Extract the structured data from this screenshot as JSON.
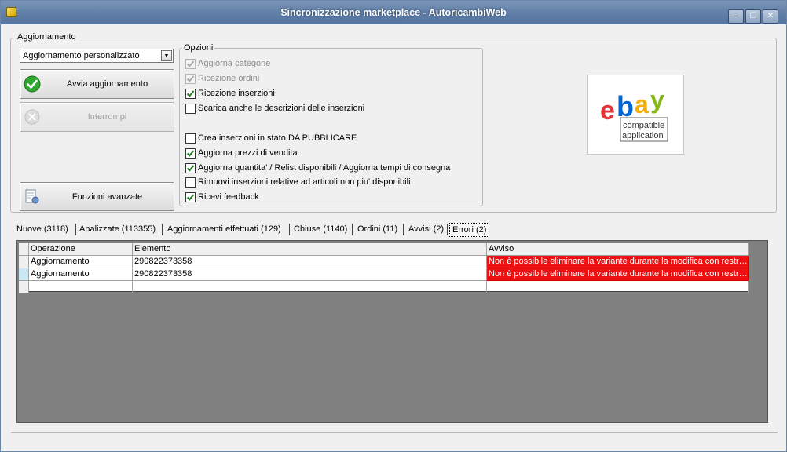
{
  "window": {
    "title": "Sincronizzazione marketplace - AutoricambiWeb",
    "controls": {
      "minimize": "—",
      "maximize": "☐",
      "close": "✕"
    }
  },
  "aggiornamento": {
    "legend": "Aggiornamento",
    "mode_select": "Aggiornamento personalizzato",
    "start_button": "Avvia aggiornamento",
    "stop_button": "Interrompi",
    "advanced_button": "Funzioni avanzate"
  },
  "opzioni": {
    "legend": "Opzioni",
    "items": [
      {
        "label": "Aggiorna categorie",
        "checked": true,
        "enabled": false
      },
      {
        "label": "Ricezione ordini",
        "checked": true,
        "enabled": false
      },
      {
        "label": "Ricezione inserzioni",
        "checked": true,
        "enabled": true
      },
      {
        "label": "Scarica anche le descrizioni delle inserzioni",
        "checked": false,
        "enabled": true
      },
      {
        "label": "Crea inserzioni in stato DA PUBBLICARE",
        "checked": false,
        "enabled": true
      },
      {
        "label": "Aggiorna prezzi di vendita",
        "checked": true,
        "enabled": true
      },
      {
        "label": "Aggiorna quantita' / Relist disponibili / Aggiorna tempi di consegna",
        "checked": true,
        "enabled": true
      },
      {
        "label": "Rimuovi inserzioni relative ad articoli non piu' disponibili",
        "checked": false,
        "enabled": true
      },
      {
        "label": "Ricevi feedback",
        "checked": true,
        "enabled": true
      }
    ]
  },
  "logo": {
    "letters": [
      "e",
      "b",
      "a",
      "y"
    ],
    "line1": "compatible",
    "line2": "application"
  },
  "tabs": [
    {
      "label": "Nuove (3118)"
    },
    {
      "label": "Analizzate (113355)"
    },
    {
      "label": "Aggiornamenti effettuati (129)"
    },
    {
      "label": "Chiuse (1140)"
    },
    {
      "label": "Ordini (11)"
    },
    {
      "label": "Avvisi (2)"
    },
    {
      "label": "Errori (2)",
      "active": true
    }
  ],
  "grid": {
    "columns": [
      "Operazione",
      "Elemento",
      "Avviso"
    ],
    "rows": [
      [
        "Aggiornamento",
        "290822373358",
        "Non è possibile eliminare la variante durante la modifica con restri..."
      ],
      [
        "Aggiornamento",
        "290822373358",
        "Non è possibile eliminare la variante durante la modifica con restri..."
      ]
    ]
  }
}
